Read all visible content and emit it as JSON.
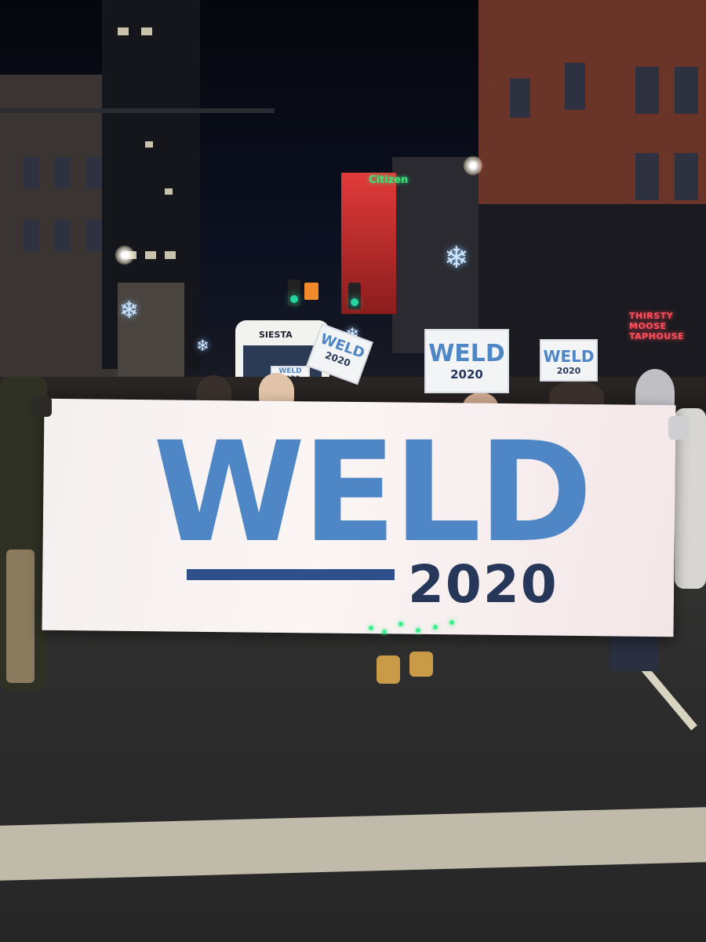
{
  "scene": {
    "banner": {
      "name": "WELD",
      "year": "2020"
    },
    "signs": [
      {
        "name": "WELD",
        "year": "2020"
      },
      {
        "name": "WELD",
        "year": "2020"
      },
      {
        "name": "WELD",
        "year": "2020"
      }
    ],
    "bus_label": "SIESTA",
    "bus_sign": {
      "name": "WELD",
      "year": "2020"
    },
    "storefront_sign": "THIRSTY MOOSE TAPHOUSE",
    "tower_sign": "Citizen",
    "colors": {
      "banner_blue": "#4f86c6",
      "banner_navy": "#26375a",
      "led_green": "#3cf08a"
    }
  }
}
